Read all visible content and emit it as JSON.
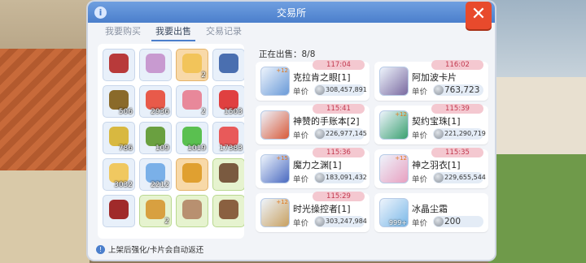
{
  "window": {
    "title": "交易所",
    "info": "i",
    "close": "✕"
  },
  "tabs": [
    {
      "label": "我要购买",
      "active": false
    },
    {
      "label": "我要出售",
      "active": true
    },
    {
      "label": "交易记录",
      "active": false
    }
  ],
  "inventory": [
    {
      "count": "",
      "color": "#b83a3a",
      "style": ""
    },
    {
      "count": "",
      "color": "#c89ad0",
      "style": ""
    },
    {
      "count": "2",
      "color": "#f2c45a",
      "style": "gold"
    },
    {
      "count": "",
      "color": "#4a6fb0",
      "style": ""
    },
    {
      "count": "506",
      "color": "#8a6a2a",
      "style": ""
    },
    {
      "count": "2936",
      "color": "#e85a4a",
      "style": ""
    },
    {
      "count": "2",
      "color": "#e8889a",
      "style": ""
    },
    {
      "count": "1503",
      "color": "#e04040",
      "style": ""
    },
    {
      "count": "786",
      "color": "#d8b840",
      "style": ""
    },
    {
      "count": "109",
      "color": "#6aa040",
      "style": ""
    },
    {
      "count": "1019",
      "color": "#5ac050",
      "style": ""
    },
    {
      "count": "17383",
      "color": "#e85a5a",
      "style": ""
    },
    {
      "count": "3032",
      "color": "#f0c860",
      "style": ""
    },
    {
      "count": "2212",
      "color": "#7ab0e8",
      "style": ""
    },
    {
      "count": "",
      "color": "#e0a030",
      "style": "gold"
    },
    {
      "count": "",
      "color": "#7a5a40",
      "style": "green"
    },
    {
      "count": "",
      "color": "#a02a2a",
      "style": ""
    },
    {
      "count": "2",
      "color": "#d8a040",
      "style": "green"
    },
    {
      "count": "",
      "color": "#b89070",
      "style": "green"
    },
    {
      "count": "",
      "color": "#8a6040",
      "style": "green"
    }
  ],
  "hint": "上架后强化/卡片会自动返还",
  "selling": {
    "count_label": "正在出售：",
    "count": "8/8",
    "price_label": "单价",
    "items": [
      {
        "name": "克拉肯之眼[1]",
        "timer": "117:04",
        "price": "308,457,891",
        "big": false,
        "qty": "",
        "plus": "+12",
        "color": "#6a9ad8"
      },
      {
        "name": "阿加波卡片",
        "timer": "116:02",
        "price": "763,723",
        "big": true,
        "qty": "",
        "plus": "",
        "color": "#7a6aa0"
      },
      {
        "name": "神赞的手账本[2]",
        "timer": "115:41",
        "price": "226,977,145",
        "big": false,
        "qty": "",
        "plus": "",
        "color": "#d85a3a"
      },
      {
        "name": "契约宝珠[1]",
        "timer": "115:39",
        "price": "221,290,719",
        "big": false,
        "qty": "",
        "plus": "+12",
        "color": "#3aa070"
      },
      {
        "name": "魔力之渊[1]",
        "timer": "115:36",
        "price": "183,091,432",
        "big": false,
        "qty": "",
        "plus": "+15",
        "color": "#4a6ac0"
      },
      {
        "name": "神之羽衣[1]",
        "timer": "115:35",
        "price": "229,655,544",
        "big": false,
        "qty": "",
        "plus": "+12",
        "color": "#e8a0c0"
      },
      {
        "name": "时光操控者[1]",
        "timer": "115:29",
        "price": "303,247,984",
        "big": false,
        "qty": "",
        "plus": "+12",
        "color": "#c8a060"
      },
      {
        "name": "冰晶尘霜",
        "timer": "",
        "price": "200",
        "big": true,
        "qty": "999+",
        "plus": "",
        "color": "#7ab8e8"
      }
    ]
  }
}
